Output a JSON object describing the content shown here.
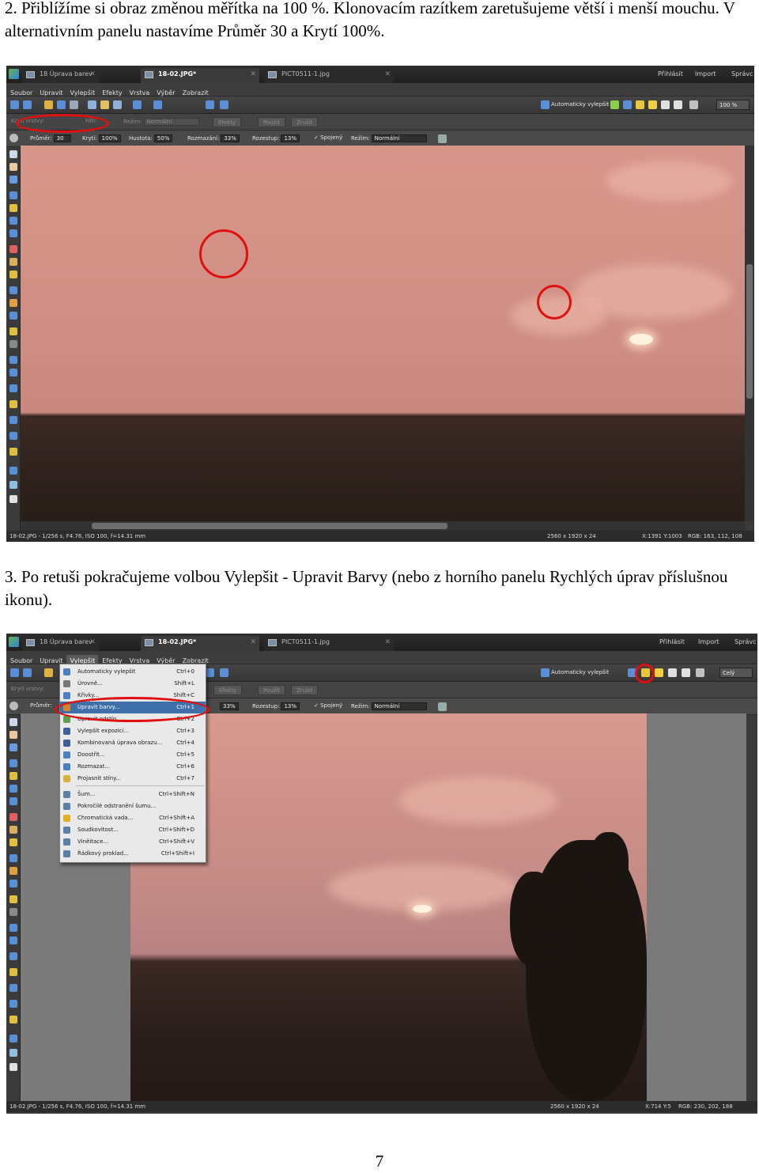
{
  "step2": {
    "text": "2. Přiblížíme si obraz změnou měřítka na 100 %. Klonovacím razítkem zaretušujeme větší i menší mouchu. V alternativním panelu nastavíme Průměr 30 a Krytí 100%."
  },
  "step3": {
    "text": "3. Po retuši pokračujeme volbou Vylepšit - Upravit Barvy (nebo z horního panelu Rychlých úprav příslušnou ikonu)."
  },
  "page_number": "7",
  "app": {
    "tab_left": "18 Úprava barev",
    "tab_active": "18-02.JPG*",
    "tab_right": "PICT0511-1.jpg",
    "link_login": "Přihlásit",
    "link_import": "Import",
    "link_admin": "Správc",
    "menu": [
      "Soubor",
      "Upravit",
      "Vylepšit",
      "Efekty",
      "Vrstva",
      "Výběr",
      "Zobrazit"
    ],
    "auto_enhance": "Automaticky vylepšit"
  },
  "shot1": {
    "zoom": "100 %",
    "layers_bar": {
      "opacity_label": "Krytí vrstvy:",
      "filter_label": "Filtr:",
      "mode_label": "Režim:",
      "mode_value": "Normální",
      "effects": "Efekty",
      "apply": "Použít",
      "cancel": "Zrušit"
    },
    "options": {
      "diameter_label": "Průměr:",
      "diameter_value": "30",
      "opacity_label": "Krytí:",
      "opacity_value": "100%",
      "density_label": "Hustota:",
      "density_value": "50%",
      "blur_label": "Rozmazání:",
      "blur_value": "33%",
      "spread_label": "Rozestup:",
      "spread_value": "13%",
      "aligned_label": "Spojený",
      "mode_label": "Režim:",
      "mode_value": "Normální"
    },
    "status_left": "18-02.JPG - 1/256 s, F4.76, ISO 100, f=14.31 mm",
    "status_size": "2560 x 1920 x 24",
    "status_xy": "X:1391 Y:1003",
    "status_rgb": "RGB: 163, 112, 108"
  },
  "shot2": {
    "zoom": "Celý",
    "layers_bar": {
      "opacity_label": "Krytí vrstvy:",
      "mode_label": "Režim:",
      "effects": "Efekty",
      "apply": "Použít",
      "cancel": "Zrušit"
    },
    "options": {
      "diameter_label": "Průměr:",
      "blur_value": "33%",
      "spread_label": "Rozestup:",
      "spread_value": "13%",
      "aligned_label": "Spojený",
      "mode_label": "Režim:",
      "mode_value": "Normální"
    },
    "menu_items": [
      {
        "label": "Automaticky vylepšit",
        "shortcut": "Ctrl+0",
        "icon_color": "#4a7fc1"
      },
      {
        "label": "Úrovně...",
        "shortcut": "Shift+L",
        "icon_color": "#777777"
      },
      {
        "label": "Křivky...",
        "shortcut": "Shift+C",
        "icon_color": "#4a7fc1"
      },
      {
        "label": "Upravit barvy...",
        "shortcut": "Ctrl+1",
        "icon_color": "#d9822b",
        "highlighted": true
      },
      {
        "label": "Upravit odstín...",
        "shortcut": "Ctrl+2",
        "icon_color": "#5aa04a"
      },
      {
        "label": "Vylepšit expozici...",
        "shortcut": "Ctrl+3",
        "icon_color": "#3f5f9f"
      },
      {
        "label": "Kombinovaná úprava obrazu...",
        "shortcut": "Ctrl+4",
        "icon_color": "#3f5f9f"
      },
      {
        "label": "Doostřit...",
        "shortcut": "Ctrl+5",
        "icon_color": "#4a7fc1"
      },
      {
        "label": "Rozmazat...",
        "shortcut": "Ctrl+6",
        "icon_color": "#4a7fc1"
      },
      {
        "label": "Projasnit stíny...",
        "shortcut": "Ctrl+7",
        "icon_color": "#d8b23a"
      },
      {
        "label": "Šum...",
        "shortcut": "Ctrl+Shift+N",
        "icon_color": "#5a7fa8"
      },
      {
        "label": "Pokročilé odstranění šumu...",
        "shortcut": "",
        "icon_color": "#5a7fa8"
      },
      {
        "label": "Chromatická vada...",
        "shortcut": "Ctrl+Shift+A",
        "icon_color": "#e0b020"
      },
      {
        "label": "Soudkovitost...",
        "shortcut": "Ctrl+Shift+D",
        "icon_color": "#5a7fa8"
      },
      {
        "label": "Viněitace...",
        "shortcut": "Ctrl+Shift+V",
        "icon_color": "#5a7fa8"
      },
      {
        "label": "Řádkový prokl­ad...",
        "shortcut": "Ctrl+Shift+I",
        "icon_color": "#5a7fa8"
      }
    ],
    "status_left": "18-02.JPG - 1/256 s, F4.76, ISO 100, f=14.31 mm",
    "status_size": "2560 x 1920 x 24",
    "status_xy": "X:714 Y:5",
    "status_rgb": "RGB: 230, 202, 188"
  },
  "colors": {
    "annotation_red": "#e01010",
    "menu_highlight": "#3f6fa8"
  }
}
